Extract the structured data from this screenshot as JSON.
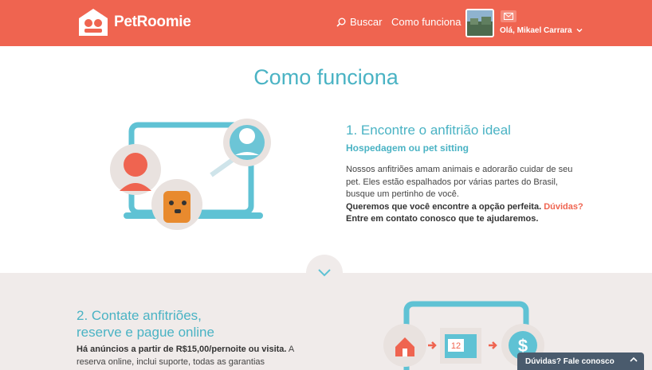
{
  "header": {
    "brand": "PetRoomie",
    "search_label": "Buscar",
    "how_label": "Como funciona",
    "user_greeting": "Olá, Mikael Carrara",
    "icons": [
      "search-icon",
      "mail-icon",
      "chevron-down-icon"
    ]
  },
  "page": {
    "title": "Como funciona"
  },
  "step1": {
    "title": "1. Encontre o anfitrião ideal",
    "subtitle": "Hospedagem ou pet sitting",
    "body": "Nossos anfitriões amam animais e adorarão cuidar de seu pet. Eles estão espalhados por várias partes do Brasil, busque um pertinho de você.",
    "strong_line": "Queremos que você encontre a opção perfeita.",
    "link": "Dúvidas?",
    "strong_line2": "Entre em contato conosco que te ajudaremos."
  },
  "step2": {
    "title_line1": "2. Contate anfitriões,",
    "title_line2": "reserve e pague online",
    "strong": "Há anúncios a partir de R$15,00/pernoite ou visita.",
    "body": " A reserva online, inclui suporte, todas as garantias",
    "calendar_day": "12"
  },
  "help_widget": {
    "label": "Dúvidas? Fale conosco"
  },
  "colors": {
    "brand": "#ef6450",
    "accent": "#4ab3c4",
    "section_bg": "#f0ebea",
    "widget": "#4a5b6d"
  }
}
